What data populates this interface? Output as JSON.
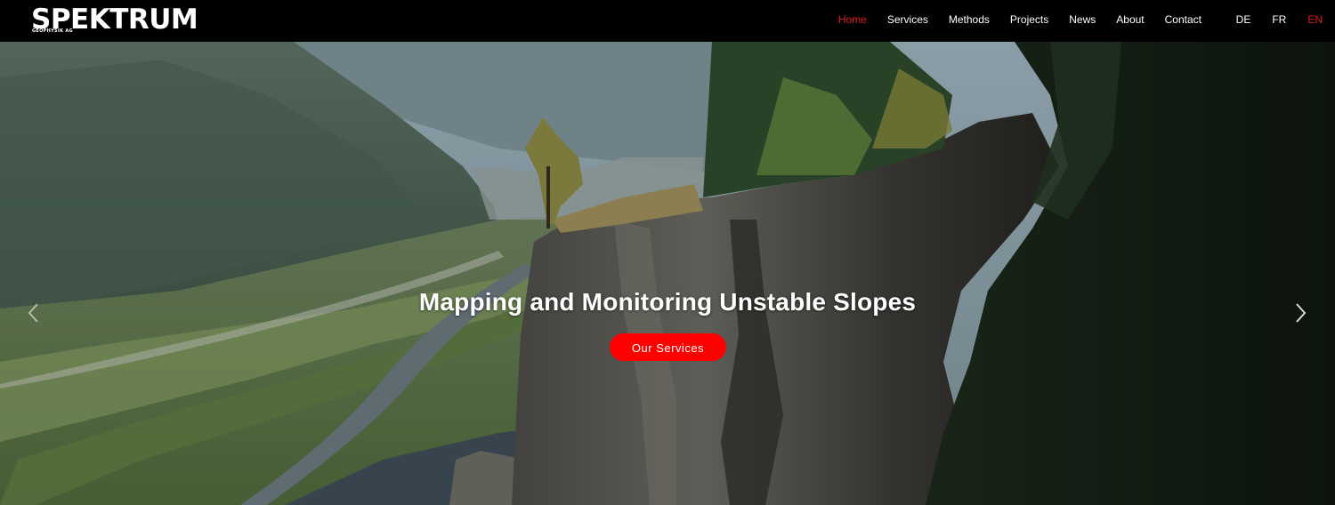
{
  "header": {
    "logo": {
      "wordmark": "SPEKTRUM",
      "subline": "GEOPHYSIK AG"
    },
    "nav": [
      {
        "label": "Home",
        "active": true
      },
      {
        "label": "Services",
        "active": false
      },
      {
        "label": "Methods",
        "active": false
      },
      {
        "label": "Projects",
        "active": false
      },
      {
        "label": "News",
        "active": false
      },
      {
        "label": "About",
        "active": false
      },
      {
        "label": "Contact",
        "active": false
      }
    ],
    "languages": [
      {
        "label": "DE",
        "active": false
      },
      {
        "label": "FR",
        "active": false
      },
      {
        "label": "EN",
        "active": true
      }
    ]
  },
  "hero": {
    "title": "Mapping and Monitoring Unstable Slopes",
    "cta_label": "Our Services",
    "icons": {
      "next": "chevron-right-icon",
      "prev": "chevron-left-icon"
    }
  },
  "colors": {
    "header_bg": "#000000",
    "accent": "#e11b1b",
    "button": "#ff0000",
    "text": "#ffffff"
  }
}
